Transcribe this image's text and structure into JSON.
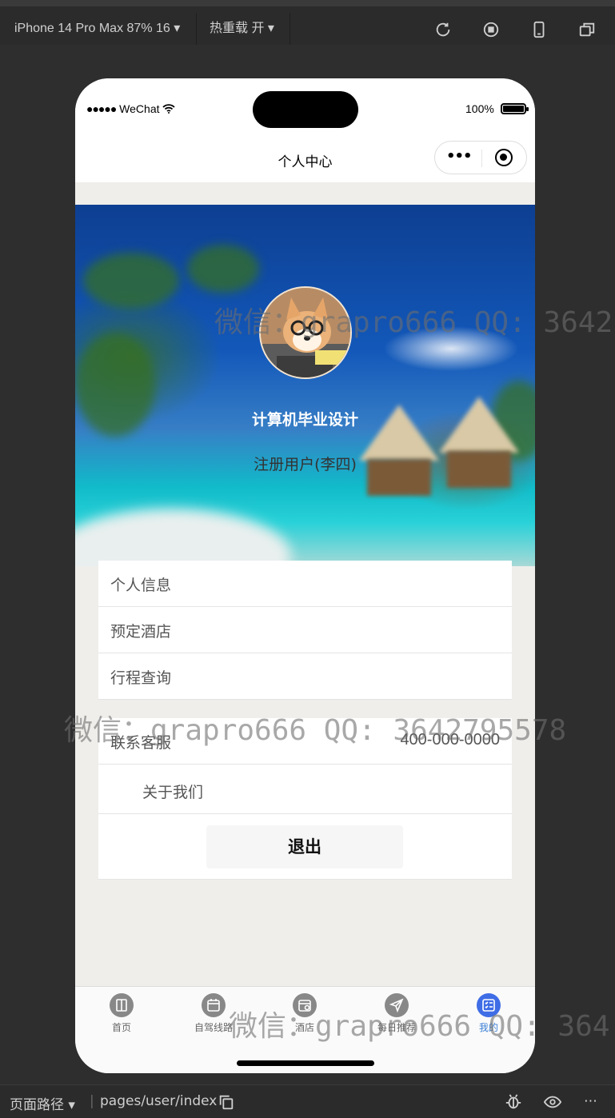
{
  "devtools": {
    "device_label": "iPhone 14 Pro Max 87% 16",
    "hot_reload_label": "热重载 开",
    "page_path_label": "页面路径",
    "page_path": "pages/user/index"
  },
  "statusbar": {
    "carrier": "WeChat",
    "battery": "100%"
  },
  "navbar": {
    "title": "个人中心"
  },
  "profile": {
    "name": "计算机毕业设计",
    "role": "注册用户(李四)"
  },
  "menu_group_1": [
    {
      "label": "个人信息"
    },
    {
      "label": "预定酒店"
    },
    {
      "label": "行程查询"
    }
  ],
  "menu_group_2": {
    "service_label": "联系客服",
    "service_phone": "400-000-0000",
    "about_label": "关于我们",
    "logout_label": "退出"
  },
  "tabbar": [
    {
      "label": "首页",
      "icon": "book-icon"
    },
    {
      "label": "自驾线路",
      "icon": "calendar-icon"
    },
    {
      "label": "酒店",
      "icon": "calendar-clock-icon"
    },
    {
      "label": "每日推荐",
      "icon": "send-icon"
    },
    {
      "label": "我的",
      "icon": "list-icon",
      "active": true
    }
  ],
  "watermarks": [
    "微信：grapro666 QQ: 3642",
    "微信：grapro666 QQ: 3642795578",
    "微信：grapro666 QQ: 364"
  ],
  "colors": {
    "accent": "#3f6de6",
    "tab_active_text": "#3b7fd6"
  }
}
